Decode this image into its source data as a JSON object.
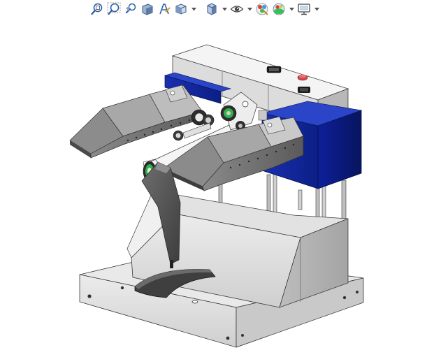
{
  "window": {
    "title": ""
  },
  "toolbar": {
    "items": [
      {
        "name": "zoom-to-fit-icon",
        "has_dropdown": false
      },
      {
        "name": "zoom-to-area-icon",
        "has_dropdown": false
      },
      {
        "name": "previous-view-icon",
        "has_dropdown": false
      },
      {
        "name": "section-view-icon",
        "has_dropdown": false
      },
      {
        "name": "dynamic-annotation-icon",
        "has_dropdown": false
      },
      {
        "name": "view-orientation-icon",
        "has_dropdown": true
      },
      {
        "name": "display-style-icon",
        "has_dropdown": true
      },
      {
        "name": "hide-show-items-icon",
        "has_dropdown": true
      },
      {
        "name": "edit-appearance-icon",
        "has_dropdown": false
      },
      {
        "name": "apply-scene-icon",
        "has_dropdown": true
      },
      {
        "name": "view-settings-icon",
        "has_dropdown": true
      }
    ]
  },
  "colors": {
    "accent_blue": "#0b1f86",
    "machine_gray": "#c8c8c8",
    "dark_gray": "#4e4e4e",
    "roller_green": "#33b14a"
  }
}
